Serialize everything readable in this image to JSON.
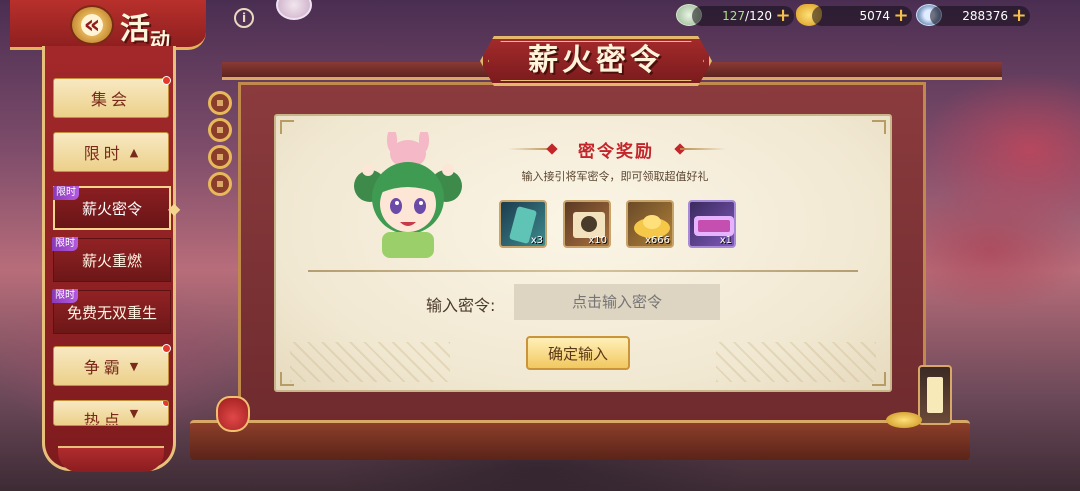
{
  "header": {
    "title_main": "活",
    "title_small": "动",
    "back_glyph": "«",
    "info_glyph": "i"
  },
  "resources": [
    {
      "icon": "stamina-icon",
      "current": "127",
      "max": "/120"
    },
    {
      "icon": "gold-ingot-icon",
      "value": "5074"
    },
    {
      "icon": "jade-coin-icon",
      "value": "288376"
    }
  ],
  "sidebar": {
    "items": [
      {
        "label": "集会",
        "type": "category"
      },
      {
        "label": "限时",
        "type": "category",
        "arrow": "▲"
      },
      {
        "label": "薪火密令",
        "tag": "限时",
        "active": true
      },
      {
        "label": "薪火重燃",
        "tag": "限时"
      },
      {
        "label": "免费无双重生",
        "tag": "限时"
      },
      {
        "label": "争霸",
        "type": "category",
        "arrow": "▼"
      },
      {
        "label": "热点",
        "type": "category",
        "arrow": "▼"
      }
    ]
  },
  "panel": {
    "title": "薪火密令",
    "reward_title": "密令奖励",
    "subtitle": "输入接引将军密令，即可领取超值好礼",
    "rewards": [
      {
        "icon": "jade-token-icon",
        "count": "x3"
      },
      {
        "icon": "general-scroll-icon",
        "count": "x10"
      },
      {
        "icon": "gold-ingot-icon",
        "count": "x666"
      },
      {
        "icon": "event-ticket-icon",
        "count": "x1"
      }
    ],
    "input_label": "输入密令:",
    "input_placeholder": "点击输入密令",
    "confirm_label": "确定输入"
  },
  "colors": {
    "accent_red": "#a3282a",
    "gold": "#e3b868",
    "parchment": "#f1e8d2",
    "reward_red": "#c3252b"
  }
}
